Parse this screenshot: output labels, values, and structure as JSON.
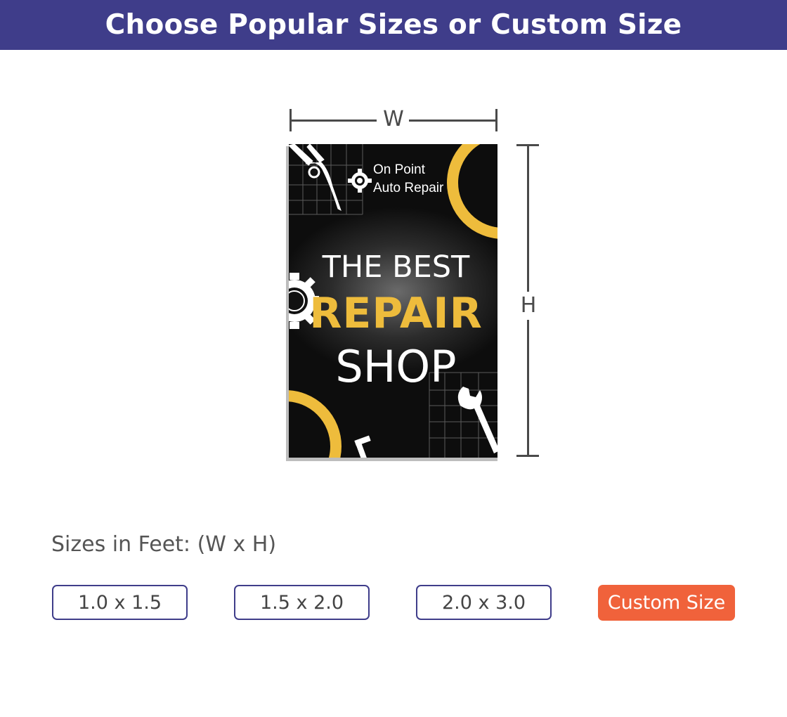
{
  "header": {
    "title": "Choose Popular Sizes or Custom Size"
  },
  "dimensions": {
    "width_label": "W",
    "height_label": "H"
  },
  "sign": {
    "brand_line1": "On Point",
    "brand_line2": "Auto Repair",
    "headline_1": "THE BEST",
    "headline_2": "REPAIR",
    "headline_3": "SHOP",
    "accent_color": "#eebc3c"
  },
  "sizes": {
    "label": "Sizes in Feet: (W x H)",
    "options": [
      "1.0 x 1.5",
      "1.5 x 2.0",
      "2.0 x 3.0"
    ],
    "custom_label": "Custom Size"
  },
  "colors": {
    "header_bg": "#3f3d8a",
    "custom_button": "#f0623b"
  }
}
